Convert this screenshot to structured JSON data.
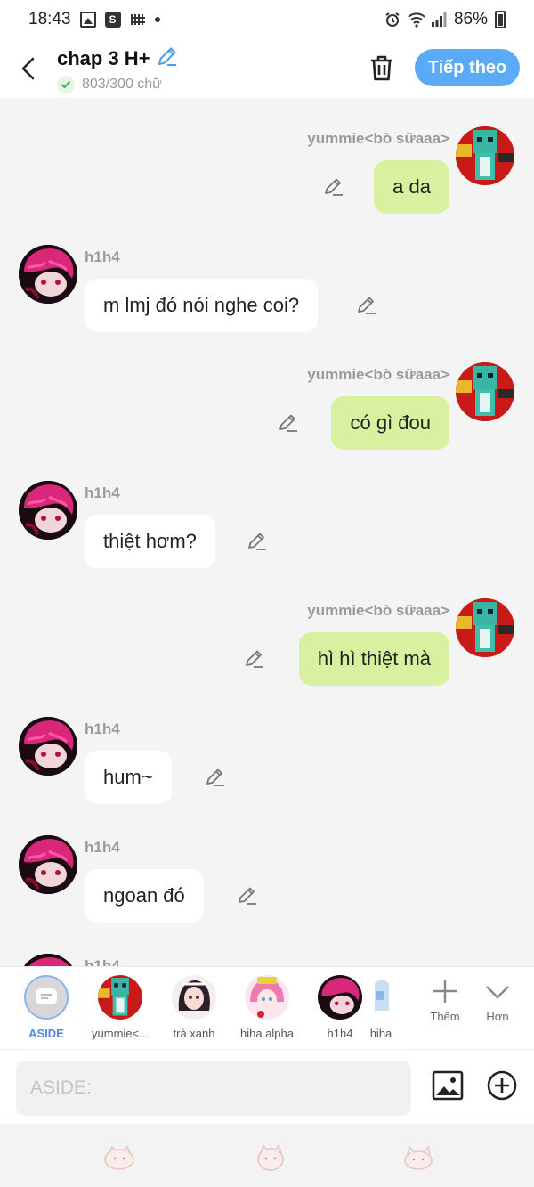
{
  "status_bar": {
    "time": "18:43",
    "battery": "86%"
  },
  "header": {
    "title": "chap 3 H+",
    "word_count": "803/300 chữ",
    "next_button": "Tiếp theo"
  },
  "messages": [
    {
      "side": "right",
      "sender": "yummie<bò sữaaa>",
      "text": "a da"
    },
    {
      "side": "left",
      "sender": "h1h4",
      "text": "m lmj đó nói nghe coi?"
    },
    {
      "side": "right",
      "sender": "yummie<bò sữaaa>",
      "text": "có gì đou"
    },
    {
      "side": "left",
      "sender": "h1h4",
      "text": "thiệt hơm?"
    },
    {
      "side": "right",
      "sender": "yummie<bò sữaaa>",
      "text": "hì hì thiệt mà"
    },
    {
      "side": "left",
      "sender": "h1h4",
      "text": "hum~"
    },
    {
      "side": "left",
      "sender": "h1h4",
      "text": "ngoan đó"
    },
    {
      "side": "left",
      "sender": "h1h4",
      "text": ""
    }
  ],
  "characters": [
    {
      "label": "ASIDE"
    },
    {
      "label": "yummie<..."
    },
    {
      "label": "trà xanh"
    },
    {
      "label": "hiha alpha"
    },
    {
      "label": "h1h4"
    },
    {
      "label": "hiha"
    }
  ],
  "bar_buttons": {
    "more": "Thêm",
    "expand": "Hơn"
  },
  "input": {
    "placeholder": "ASIDE:"
  },
  "colors": {
    "accent": "#5aabf7",
    "my_bubble": "#d8f1a0",
    "other_bubble": "#ffffff",
    "background": "#f4f4f4"
  }
}
